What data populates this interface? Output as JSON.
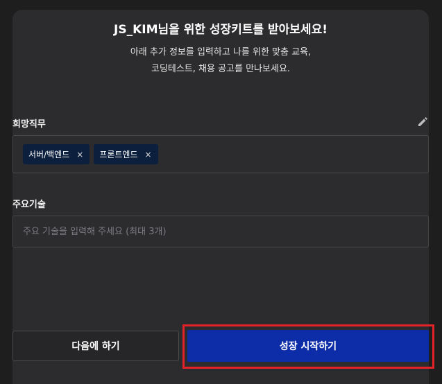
{
  "modal": {
    "title": "JS_KIM님을 위한 성장키트를 받아보세요!",
    "subtitle_line1": "아래 추가 정보를 입력하고 나를 위한 맞춤 교육,",
    "subtitle_line2": "코딩테스트, 채용 공고를 만나보세요."
  },
  "desired_job": {
    "label": "희망직무",
    "edit_icon": "pencil-icon",
    "tags": [
      {
        "label": "서버/백엔드",
        "remove": "×"
      },
      {
        "label": "프론트엔드",
        "remove": "×"
      }
    ]
  },
  "main_skills": {
    "label": "주요기술",
    "placeholder": "주요 기술을 입력해 주세요 (최대 3개)",
    "value": ""
  },
  "actions": {
    "later_label": "다음에 하기",
    "start_label": "성장 시작하기"
  },
  "colors": {
    "background": "#1e1e1f",
    "modal": "#2c2c2e",
    "tag": "#0c1f3d",
    "primary_button": "#0c2ca8",
    "highlight": "#e3222a"
  }
}
